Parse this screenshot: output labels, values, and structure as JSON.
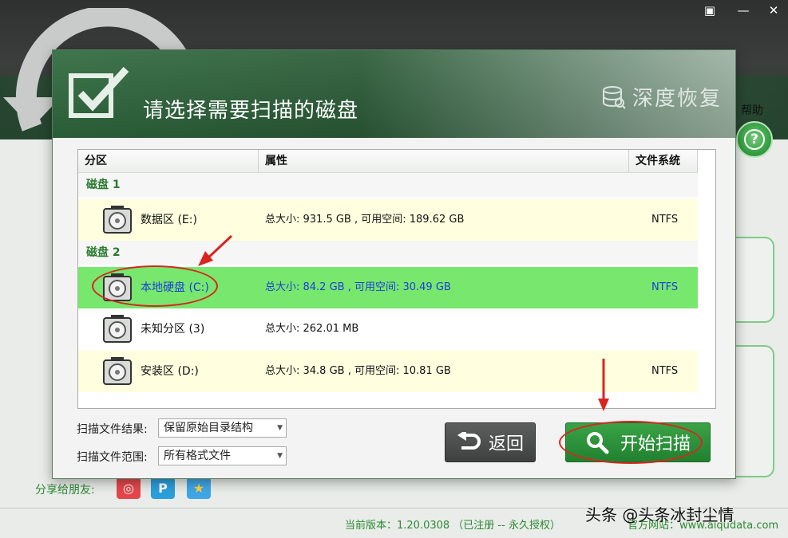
{
  "app": {
    "help_label": "帮助",
    "share_label": "分享给朋友:",
    "version_text": "当前版本：1.20.0308 （已注册 -- 永久授权）",
    "website_text": "官方网站：www.aiqudata.com",
    "watermark": "头条 @头条冰封尘情"
  },
  "dialog": {
    "title": "请选择需要扫描的磁盘",
    "brand": "深度恢复",
    "columns": {
      "partition": "分区",
      "attributes": "属性",
      "filesystem": "文件系统"
    },
    "groups": [
      {
        "label": "磁盘 1"
      },
      {
        "label": "磁盘 2"
      }
    ],
    "rows": [
      {
        "name": "数据区 (E:)",
        "attr": "总大小: 931.5 GB , 可用空间: 189.62 GB",
        "fs": "NTFS"
      },
      {
        "name": "本地硬盘 (C:)",
        "attr": "总大小: 84.2 GB , 可用空间: 30.49 GB",
        "fs": "NTFS"
      },
      {
        "name": "未知分区 (3)",
        "attr": "总大小: 262.01 MB",
        "fs": ""
      },
      {
        "name": "安装区 (D:)",
        "attr": "总大小: 34.8 GB , 可用空间: 10.81 GB",
        "fs": "NTFS"
      }
    ],
    "options": {
      "result_label": "扫描文件结果:",
      "result_value": "保留原始目录结构",
      "range_label": "扫描文件范围:",
      "range_value": "所有格式文件"
    },
    "buttons": {
      "back": "返回",
      "scan": "开始扫描"
    }
  },
  "colors": {
    "accent_green": "#2c7a2f",
    "selected_row": "#77e76e",
    "annotation_red": "#d8261f"
  }
}
